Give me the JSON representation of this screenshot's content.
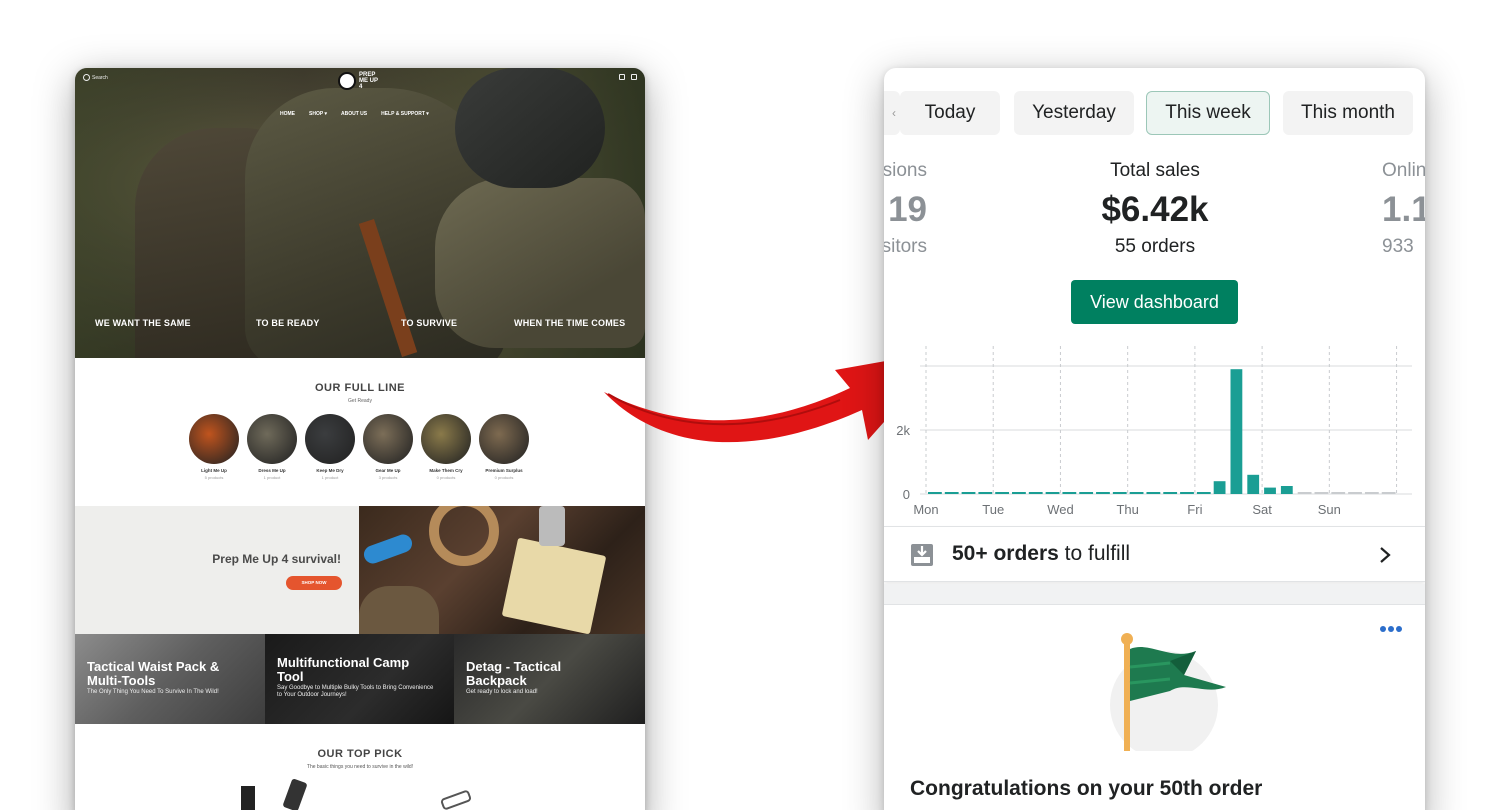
{
  "store": {
    "search_label": "Search",
    "logo_text": "PREP ME UP 4",
    "menu": [
      "HOME",
      "SHOP ▾",
      "ABOUT US",
      "HELP & SUPPORT ▾"
    ],
    "hero_words": [
      "WE WANT THE SAME",
      "TO BE READY",
      "TO SURVIVE",
      "WHEN THE TIME COMES"
    ],
    "full_line": {
      "title": "OUR FULL LINE",
      "subtitle": "Get Ready",
      "categories": [
        {
          "name": "Light Me Up",
          "count": "5 products",
          "color": "#c0541e"
        },
        {
          "name": "Dress Me Up",
          "count": "1 product",
          "color": "#6f6a5a"
        },
        {
          "name": "Keep Me Dry",
          "count": "1 product",
          "color": "#3b3d3f"
        },
        {
          "name": "Gear Me Up",
          "count": "3 products",
          "color": "#7c6e58"
        },
        {
          "name": "Make Them Cry",
          "count": "0 products",
          "color": "#8a7a4a"
        },
        {
          "name": "Premium Surplus",
          "count": "0 products",
          "color": "#7e6a50"
        }
      ]
    },
    "promo": {
      "title": "Prep Me Up 4 survival!",
      "button": "SHOP NOW"
    },
    "tiles": [
      {
        "title": "Tactical Waist Pack & Multi-Tools",
        "subtitle": "The Only Thing You Need To Survive In The Wild!"
      },
      {
        "title": "Multifunctional Camp Tool",
        "subtitle": "Say Goodbye to Multiple Bulky Tools to Bring Convenience to Your Outdoor Journeys!"
      },
      {
        "title": "Detag - Tactical Backpack",
        "subtitle": "Get ready to lock and load!"
      }
    ],
    "top_pick": {
      "title": "OUR TOP PICK",
      "subtitle": "The basic things you need to survive in the wild!"
    }
  },
  "admin": {
    "periods": [
      "Today",
      "Yesterday",
      "This week",
      "This month"
    ],
    "selected_period": "This week",
    "metrics": {
      "left": {
        "label": "sions",
        "value": "19",
        "sub": "sitors"
      },
      "center": {
        "label": "Total sales",
        "value": "$6.42k",
        "sub": "55 orders"
      },
      "right": {
        "label": "Onlin",
        "value": "1.1",
        "sub": "933"
      }
    },
    "view_dashboard": "View dashboard",
    "fulfill": {
      "bold": "50+ orders",
      "rest": " to fulfill"
    },
    "congrats": "Congratulations on your 50th order",
    "colors": {
      "primary": "#008060",
      "bar": "#1a9e94",
      "flag": "#1e7a4f"
    }
  },
  "chart_data": {
    "type": "bar",
    "ylabels": [
      "2k",
      "0"
    ],
    "ylim": [
      0,
      4000
    ],
    "xlabels": [
      "Mon",
      "Tue",
      "Wed",
      "Thu",
      "Fri",
      "Sat",
      "Sun"
    ],
    "values": [
      30,
      30,
      30,
      30,
      30,
      30,
      30,
      30,
      30,
      30,
      30,
      30,
      30,
      30,
      30,
      30,
      30,
      30,
      30,
      30,
      30,
      30,
      30,
      30,
      30,
      30,
      30,
      30,
      30,
      30,
      30,
      30,
      30,
      30,
      30,
      30,
      30,
      30,
      30,
      30,
      30,
      30,
      30,
      30,
      30,
      30,
      30,
      30,
      30,
      30,
      30,
      30,
      30,
      30,
      30,
      30,
      30,
      30,
      30,
      30,
      30,
      30,
      30,
      30,
      30,
      30,
      30,
      30,
      30,
      30,
      30,
      30,
      30,
      30,
      30,
      30,
      30,
      30,
      30,
      30,
      30,
      30,
      30,
      30,
      30,
      30,
      30,
      30,
      30,
      30,
      30,
      30,
      30,
      30,
      30,
      30,
      30,
      30,
      30,
      30,
      30,
      30,
      30,
      30,
      30,
      30,
      30,
      30,
      30,
      30,
      30,
      30,
      30,
      30,
      30,
      30,
      30,
      30,
      30,
      30,
      30,
      30,
      30,
      30,
      30,
      30,
      30,
      30,
      30,
      30,
      30,
      30,
      30,
      30,
      30,
      30,
      30,
      30,
      30,
      30,
      30,
      30,
      30,
      30,
      30,
      30,
      30,
      30,
      30,
      30,
      30,
      30,
      30,
      30,
      30,
      30,
      30,
      30,
      30,
      30,
      30,
      30,
      30,
      30
    ],
    "bar_values": [
      30,
      30,
      30,
      30,
      30,
      30,
      30,
      30,
      30,
      30,
      30,
      30,
      30,
      30,
      30,
      30,
      30,
      400,
      3900,
      600,
      200,
      250,
      0,
      0,
      0,
      0,
      0,
      0
    ]
  }
}
